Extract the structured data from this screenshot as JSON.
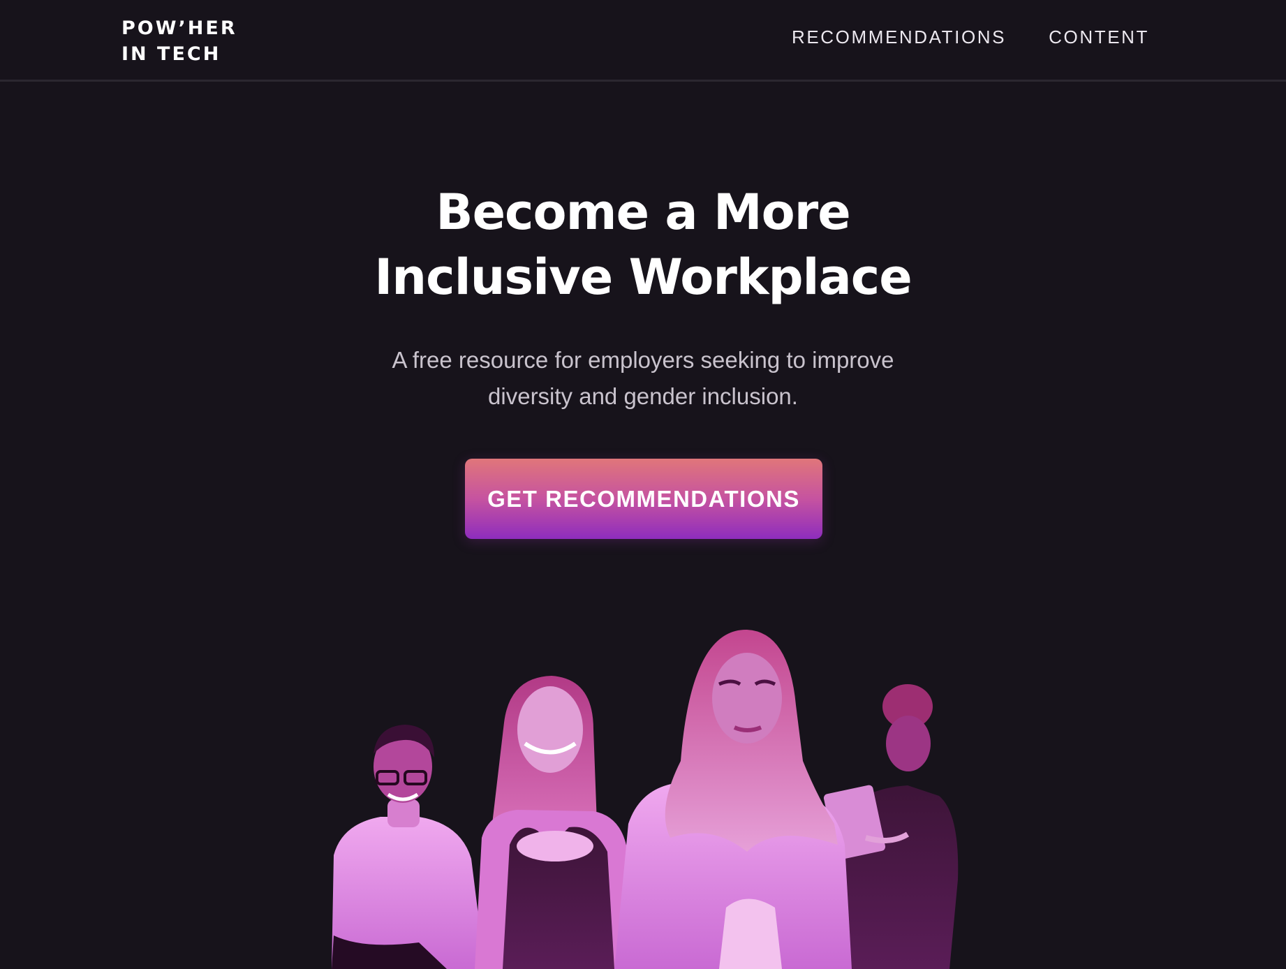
{
  "header": {
    "logo_line1": "POW’HER",
    "logo_line2": "IN TECH",
    "nav": [
      {
        "label": "RECOMMENDATIONS"
      },
      {
        "label": "CONTENT"
      }
    ]
  },
  "hero": {
    "title_line1": "Become a More",
    "title_line2": "Inclusive Workplace",
    "subtitle_line1": "A free resource for employers seeking to improve",
    "subtitle_line2": "diversity and gender inclusion.",
    "cta_label": "GET RECOMMENDATIONS"
  },
  "colors": {
    "background": "#17131b",
    "cta_top": "#e0767a",
    "cta_bottom": "#8e2dbd",
    "photo_tint": "#c24bc0"
  }
}
